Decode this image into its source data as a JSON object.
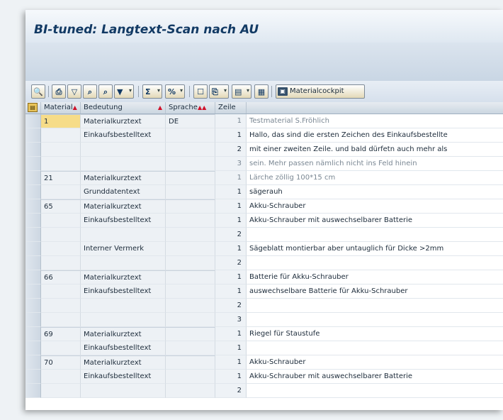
{
  "window": {
    "title": "BI-tuned: Langtext-Scan nach AU"
  },
  "toolbar": {
    "buttons": [
      {
        "icon": "details-icon",
        "glyph": "🔍"
      },
      {
        "icon": "print-icon",
        "glyph": "⎙"
      },
      {
        "icon": "filter-icon",
        "glyph": "▽"
      },
      {
        "icon": "find-icon",
        "glyph": "⌕"
      },
      {
        "icon": "find-next-icon",
        "glyph": "⌕"
      },
      {
        "icon": "set-filter-icon",
        "glyph": "▼"
      },
      {
        "icon": "sum-icon",
        "glyph": "Σ"
      },
      {
        "icon": "subtotal-icon",
        "glyph": "%"
      },
      {
        "icon": "view-icon",
        "glyph": "☐"
      },
      {
        "icon": "export-icon",
        "glyph": "⎘"
      },
      {
        "icon": "layout-icon",
        "glyph": "▤"
      },
      {
        "icon": "grid-icon",
        "glyph": "▦"
      }
    ],
    "materialcockpit_label": "Materialcockpit"
  },
  "table": {
    "columns": {
      "material": "Material",
      "bedeutung": "Bedeutung",
      "sprache": "Sprache",
      "zeile": "Zeile"
    },
    "rows": [
      {
        "material": "1",
        "bedeutung": "Materialkurztext",
        "sprache": "DE",
        "zeile": "1",
        "text": "Testmaterial S.Fröhlich",
        "grey": true
      },
      {
        "material": "",
        "bedeutung": "Einkaufsbestelltext",
        "sprache": "",
        "zeile": "1",
        "text": "Hallo, das sind die ersten Zeichen des Einkaufsbestellte",
        "grey": false
      },
      {
        "material": "",
        "bedeutung": "",
        "sprache": "",
        "zeile": "2",
        "text": "mit einer zweiten Zeile. und bald dürfetn auch mehr als",
        "grey": false
      },
      {
        "material": "",
        "bedeutung": "",
        "sprache": "",
        "zeile": "3",
        "text": "sein. Mehr passen nämlich nicht ins Feld hinein",
        "grey": true
      },
      {
        "material": "21",
        "bedeutung": "Materialkurztext",
        "sprache": "",
        "zeile": "1",
        "text": "Lärche zöllig 100*15 cm",
        "grey": true
      },
      {
        "material": "",
        "bedeutung": "Grunddatentext",
        "sprache": "",
        "zeile": "1",
        "text": "sägerauh",
        "grey": false
      },
      {
        "material": "65",
        "bedeutung": "Materialkurztext",
        "sprache": "",
        "zeile": "1",
        "text": "Akku-Schrauber",
        "grey": false
      },
      {
        "material": "",
        "bedeutung": "Einkaufsbestelltext",
        "sprache": "",
        "zeile": "1",
        "text": "Akku-Schrauber mit auswechselbarer Batterie",
        "grey": false
      },
      {
        "material": "",
        "bedeutung": "",
        "sprache": "",
        "zeile": "2",
        "text": "",
        "grey": false
      },
      {
        "material": "",
        "bedeutung": "Interner Vermerk",
        "sprache": "",
        "zeile": "1",
        "text": "Sägeblatt montierbar aber untauglich für Dicke >2mm",
        "grey": false
      },
      {
        "material": "",
        "bedeutung": "",
        "sprache": "",
        "zeile": "2",
        "text": "",
        "grey": false
      },
      {
        "material": "66",
        "bedeutung": "Materialkurztext",
        "sprache": "",
        "zeile": "1",
        "text": "Batterie für Akku-Schrauber",
        "grey": false
      },
      {
        "material": "",
        "bedeutung": "Einkaufsbestelltext",
        "sprache": "",
        "zeile": "1",
        "text": "auswechselbare Batterie für Akku-Schrauber",
        "grey": false
      },
      {
        "material": "",
        "bedeutung": "",
        "sprache": "",
        "zeile": "2",
        "text": "",
        "grey": false
      },
      {
        "material": "",
        "bedeutung": "",
        "sprache": "",
        "zeile": "3",
        "text": "",
        "grey": false
      },
      {
        "material": "69",
        "bedeutung": "Materialkurztext",
        "sprache": "",
        "zeile": "1",
        "text": "Riegel für Staustufe",
        "grey": false
      },
      {
        "material": "",
        "bedeutung": "Einkaufsbestelltext",
        "sprache": "",
        "zeile": "1",
        "text": "",
        "grey": false
      },
      {
        "material": "70",
        "bedeutung": "Materialkurztext",
        "sprache": "",
        "zeile": "1",
        "text": "Akku-Schrauber",
        "grey": false
      },
      {
        "material": "",
        "bedeutung": "Einkaufsbestelltext",
        "sprache": "",
        "zeile": "1",
        "text": "Akku-Schrauber mit auswechselbarer Batterie",
        "grey": false
      },
      {
        "material": "",
        "bedeutung": "",
        "sprache": "",
        "zeile": "2",
        "text": "",
        "grey": false
      }
    ]
  }
}
